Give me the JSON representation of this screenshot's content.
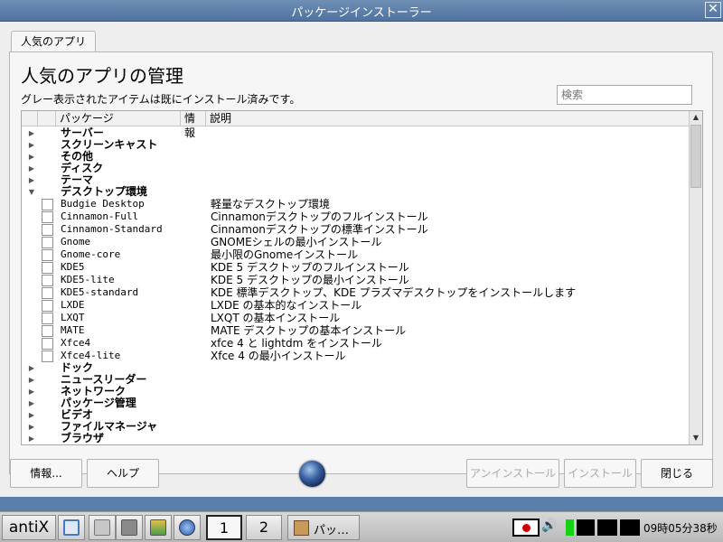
{
  "window": {
    "title": "パッケージインストーラー",
    "close_glyph": "✕"
  },
  "tab": {
    "label": "人気のアプリ"
  },
  "heading": "人気のアプリの管理",
  "subtitle": "グレー表示されたアイテムは既にインストール済みです。",
  "search": {
    "placeholder": "検索"
  },
  "columns": {
    "package": "パッケージ",
    "info": "情報",
    "description": "説明"
  },
  "categories_top": [
    {
      "name": "サーバー",
      "arrow": "▶"
    },
    {
      "name": "スクリーンキャスト",
      "arrow": "▶"
    },
    {
      "name": "その他",
      "arrow": "▶"
    },
    {
      "name": "ディスク",
      "arrow": "▶"
    },
    {
      "name": "テーマ",
      "arrow": "▶"
    },
    {
      "name": "デスクトップ環境",
      "arrow": "▼"
    }
  ],
  "packages": [
    {
      "name": "Budgie Desktop",
      "description": "軽量なデスクトップ環境"
    },
    {
      "name": "Cinnamon-Full",
      "description": "Cinnamonデスクトップのフルインストール"
    },
    {
      "name": "Cinnamon-Standard",
      "description": "Cinnamonデスクトップの標準インストール"
    },
    {
      "name": "Gnome",
      "description": "GNOMEシェルの最小インストール"
    },
    {
      "name": "Gnome-core",
      "description": "最小限のGnomeインストール"
    },
    {
      "name": "KDE5",
      "description": "KDE 5 デスクトップのフルインストール"
    },
    {
      "name": "KDE5-lite",
      "description": "KDE 5 デスクトップの最小インストール"
    },
    {
      "name": "KDE5-standard",
      "description": "KDE 標準デスクトップ、KDE プラズマデスクトップをインストールします"
    },
    {
      "name": "LXDE",
      "description": "LXDE の基本的なインストール"
    },
    {
      "name": "LXQT",
      "description": "LXQT の基本インストール"
    },
    {
      "name": "MATE",
      "description": "MATE デスクトップの基本インストール"
    },
    {
      "name": "Xfce4",
      "description": "xfce 4 と lightdm をインストール"
    },
    {
      "name": "Xfce4-lite",
      "description": "Xfce 4 の最小インストール"
    }
  ],
  "categories_bottom": [
    {
      "name": "ドック",
      "arrow": "▶"
    },
    {
      "name": "ニュースリーダー",
      "arrow": "▶"
    },
    {
      "name": "ネットワーク",
      "arrow": "▶"
    },
    {
      "name": "パッケージ管理",
      "arrow": "▶"
    },
    {
      "name": "ビデオ",
      "arrow": "▶"
    },
    {
      "name": "ファイルマネージャ",
      "arrow": "▶"
    },
    {
      "name": "ブラウザ",
      "arrow": "▶"
    }
  ],
  "buttons": {
    "info": "情報...",
    "help": "ヘルプ",
    "uninstall": "アンインストール",
    "install": "インストール",
    "close": "閉じる"
  },
  "taskbar": {
    "start": "antiX",
    "workspace_1": "1",
    "workspace_2": "2",
    "task_label": "パッ…",
    "clock": "09時05分38秒",
    "speaker": "🔊",
    "colors": {
      "meter_green": "#16d116",
      "flag_red": "#d40000"
    }
  }
}
